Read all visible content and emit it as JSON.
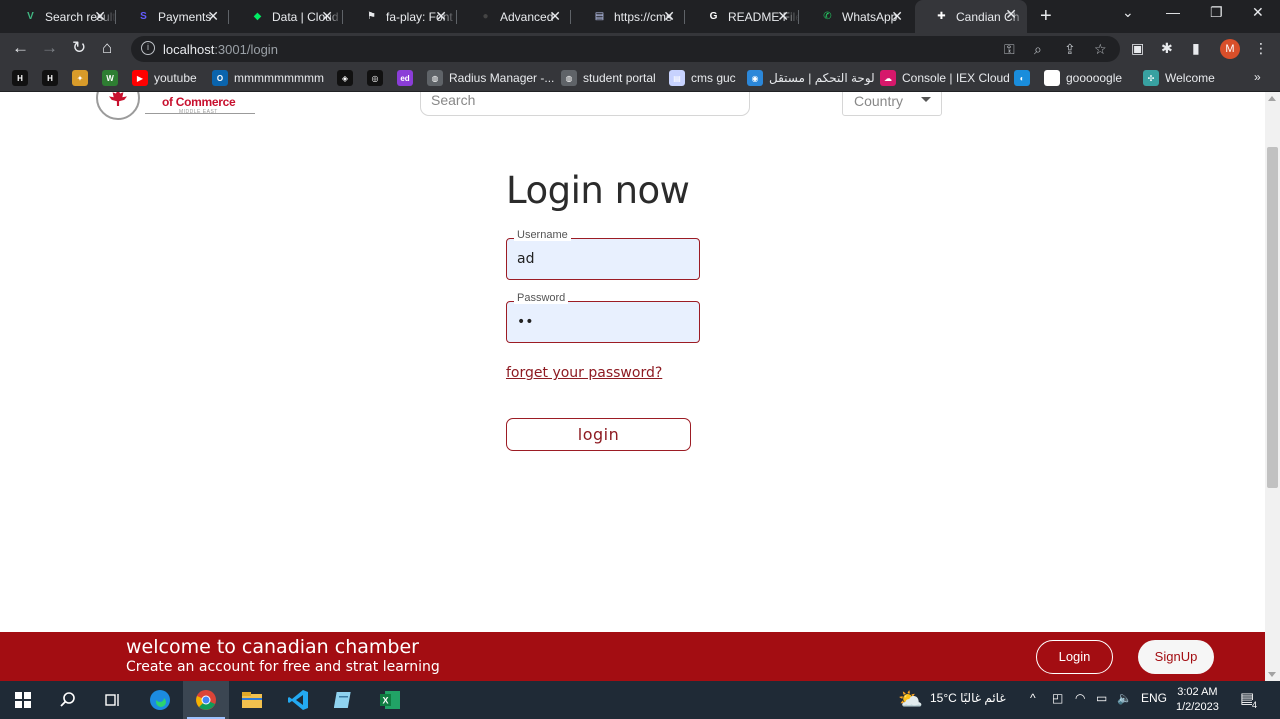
{
  "browser": {
    "tabs": [
      {
        "title": "Search results",
        "icon": "v-icon",
        "color": "#41b883",
        "glyph": "V"
      },
      {
        "title": "Payments",
        "icon": "stripe-icon",
        "color": "#635bff",
        "glyph": "S"
      },
      {
        "title": "Data | Cloud",
        "icon": "mongodb-icon",
        "color": "#00ed64",
        "glyph": "◆"
      },
      {
        "title": "fa-play: Font",
        "icon": "flag-icon",
        "color": "#e8eaed",
        "glyph": "⚑"
      },
      {
        "title": "Advanced",
        "icon": "github-icon",
        "color": "#444",
        "glyph": "●"
      },
      {
        "title": "https://cms",
        "icon": "document-icon",
        "color": "#c7d2fe",
        "glyph": "▤"
      },
      {
        "title": "README File",
        "icon": "google-icon",
        "color": "#fff",
        "glyph": "G"
      },
      {
        "title": "WhatsApp",
        "icon": "whatsapp-icon",
        "color": "#25d366",
        "glyph": "✆"
      },
      {
        "title": "Candian Ch",
        "icon": "canada-icon",
        "color": "#fff",
        "glyph": "✚"
      }
    ],
    "address": {
      "host": "localhost",
      "path": ":3001/login"
    },
    "profile_initial": "M",
    "bookmarks": [
      {
        "label": "",
        "icon": "hi-icon",
        "color": "#111",
        "glyph": "H"
      },
      {
        "label": "",
        "icon": "hi-icon",
        "color": "#111",
        "glyph": "H"
      },
      {
        "label": "",
        "icon": "bookmark-icon",
        "color": "#d89b2a",
        "glyph": "✦"
      },
      {
        "label": "",
        "icon": "w-icon",
        "color": "#2e7d32",
        "glyph": "W"
      },
      {
        "label": "youtube",
        "icon": "youtube-icon",
        "color": "#ff0000",
        "glyph": "▶"
      },
      {
        "label": "mmmmmmmmm",
        "icon": "outlook-icon",
        "color": "#0a64ad",
        "glyph": "O"
      },
      {
        "label": "",
        "icon": "codepen-icon",
        "color": "#111",
        "glyph": "◈"
      },
      {
        "label": "",
        "icon": "chatgpt-icon",
        "color": "#111",
        "glyph": "◎"
      },
      {
        "label": "",
        "icon": "ed-icon",
        "color": "#8b3dd8",
        "glyph": "ed"
      },
      {
        "label": "Radius Manager -...",
        "icon": "globe-icon",
        "color": "#5f6368",
        "glyph": "◍"
      },
      {
        "label": "student portal",
        "icon": "globe-icon",
        "color": "#5f6368",
        "glyph": "◍"
      },
      {
        "label": "cms guc",
        "icon": "document-icon",
        "color": "#c7d2fe",
        "glyph": "▤"
      },
      {
        "label": "لوحة التحكم | مستقل",
        "icon": "mostaql-icon",
        "color": "#2b87d9",
        "glyph": "◉"
      },
      {
        "label": "Console | IEX Cloud",
        "icon": "iex-icon",
        "color": "#d6186b",
        "glyph": "☁"
      },
      {
        "label": "",
        "icon": "circle-icon",
        "color": "#1a8ddc",
        "glyph": "◐"
      },
      {
        "label": "gooooogle",
        "icon": "google-icon",
        "color": "#fff",
        "glyph": "G"
      },
      {
        "label": "Welcome",
        "icon": "welcome-icon",
        "color": "#38a1a1",
        "glyph": "✣"
      }
    ]
  },
  "page": {
    "logo_text": "of Commerce",
    "logo_sub": "MIDDLE EAST",
    "search_placeholder": "Search",
    "country_label": "Country",
    "title": "Login now",
    "username_label": "Username",
    "username_value": "ad",
    "password_label": "Password",
    "password_value": "••",
    "forget_link": "forget your password?",
    "login_button": "login",
    "footer": {
      "headline": "welcome to canadian chamber",
      "subline": "Create an account for free and strat learning",
      "login": "Login",
      "signup": "SignUp"
    }
  },
  "taskbar": {
    "weather": "15°C  غائم غالبًا",
    "lang": "ENG",
    "time": "3:02 AM",
    "date": "1/2/2023",
    "notifications": "4"
  },
  "colors": {
    "brand": "#a30d12",
    "accent": "#9c1c24"
  }
}
